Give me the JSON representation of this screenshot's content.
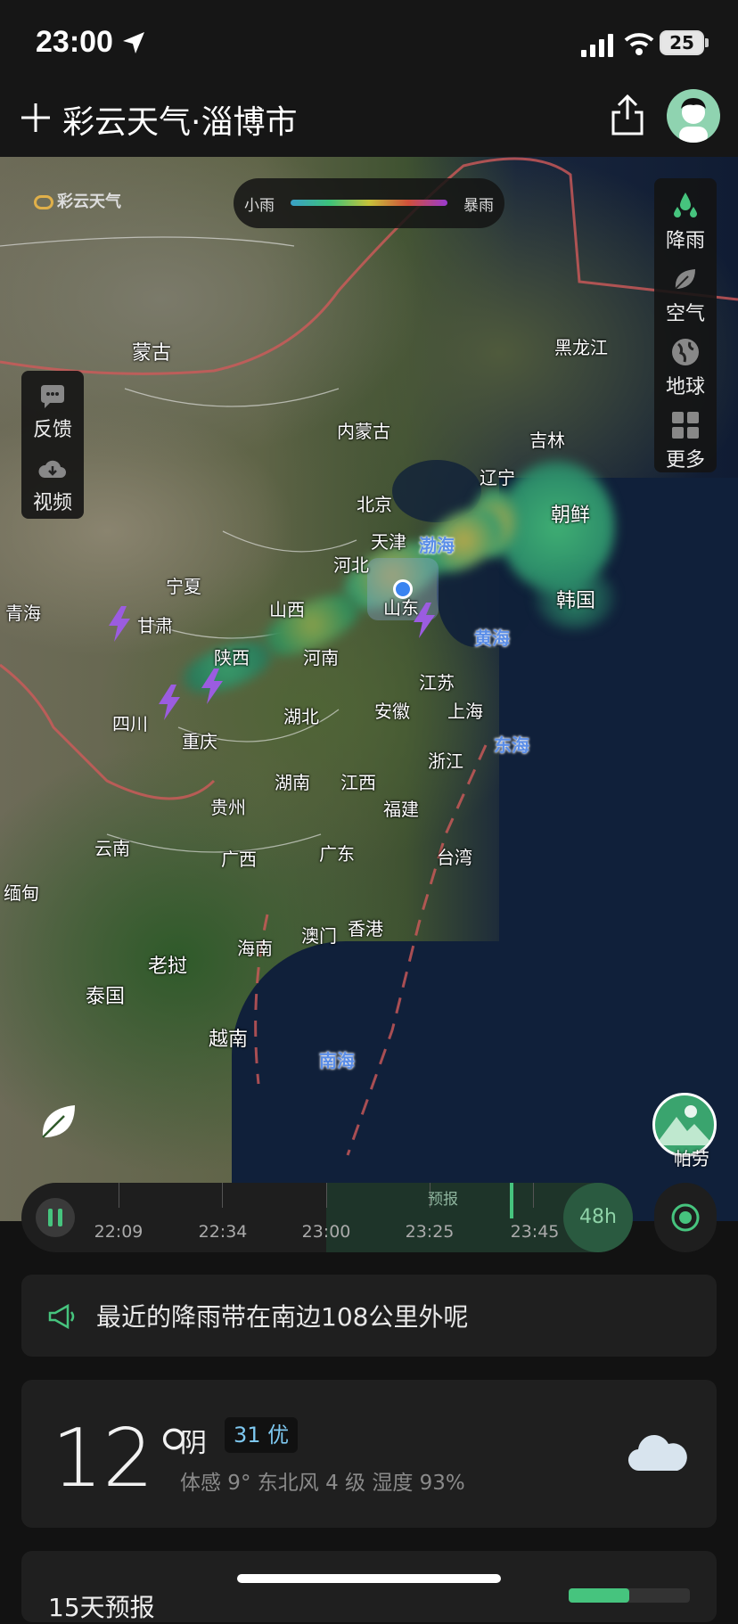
{
  "status": {
    "time": "23:00",
    "battery": "25"
  },
  "header": {
    "title": "彩云天气·淄博市"
  },
  "map": {
    "logo": "彩云天气",
    "legend": {
      "light": "小雨",
      "heavy": "暴雨"
    },
    "right_panel": [
      "降雨",
      "空气",
      "地球",
      "更多"
    ],
    "left_panel": [
      "反馈",
      "视频"
    ],
    "labels": [
      {
        "id": "mongolia",
        "text": "蒙古"
      },
      {
        "id": "heilongjiang",
        "text": "黑龙江"
      },
      {
        "id": "neimenggu",
        "text": "内蒙古"
      },
      {
        "id": "jilin",
        "text": "吉林"
      },
      {
        "id": "liaoning",
        "text": "辽宁"
      },
      {
        "id": "beijing",
        "text": "北京"
      },
      {
        "id": "tianjin",
        "text": "天津"
      },
      {
        "id": "northkorea",
        "text": "朝鲜"
      },
      {
        "id": "hebei",
        "text": "河北"
      },
      {
        "id": "ningxia",
        "text": "宁夏"
      },
      {
        "id": "qinghai",
        "text": "青海"
      },
      {
        "id": "gansu",
        "text": "甘肃"
      },
      {
        "id": "shanxi",
        "text": "山西"
      },
      {
        "id": "shandong",
        "text": "山东"
      },
      {
        "id": "southkorea",
        "text": "韩国"
      },
      {
        "id": "shaanxi",
        "text": "陕西"
      },
      {
        "id": "henan",
        "text": "河南"
      },
      {
        "id": "jiangsu",
        "text": "江苏"
      },
      {
        "id": "sichuan",
        "text": "四川"
      },
      {
        "id": "hubei",
        "text": "湖北"
      },
      {
        "id": "anhui",
        "text": "安徽"
      },
      {
        "id": "shanghai",
        "text": "上海"
      },
      {
        "id": "chongqing",
        "text": "重庆"
      },
      {
        "id": "zhejiang",
        "text": "浙江"
      },
      {
        "id": "hunan",
        "text": "湖南"
      },
      {
        "id": "jiangxi",
        "text": "江西"
      },
      {
        "id": "guizhou",
        "text": "贵州"
      },
      {
        "id": "fujian",
        "text": "福建"
      },
      {
        "id": "yunnan",
        "text": "云南"
      },
      {
        "id": "guangxi",
        "text": "广西"
      },
      {
        "id": "guangdong",
        "text": "广东"
      },
      {
        "id": "taiwan",
        "text": "台湾"
      },
      {
        "id": "myanmar",
        "text": "缅甸"
      },
      {
        "id": "hainan",
        "text": "海南"
      },
      {
        "id": "macau",
        "text": "澳门"
      },
      {
        "id": "hongkong",
        "text": "香港"
      },
      {
        "id": "laos",
        "text": "老挝"
      },
      {
        "id": "thailand",
        "text": "泰国"
      },
      {
        "id": "vietnam",
        "text": "越南"
      },
      {
        "id": "philippines",
        "text": "帕劳"
      }
    ],
    "seas": [
      {
        "id": "bohai",
        "text": "渤海"
      },
      {
        "id": "huanghai",
        "text": "黄海"
      },
      {
        "id": "donghai",
        "text": "东海"
      },
      {
        "id": "nanhai",
        "text": "南海"
      }
    ]
  },
  "timeline": {
    "forecast_label": "预报",
    "times": [
      "22:09",
      "22:34",
      "23:00",
      "23:25",
      "23:45"
    ],
    "range": "48h"
  },
  "notice": {
    "text": "最近的降雨带在南边108公里外呢"
  },
  "weather": {
    "temp": "12°",
    "condition": "阴",
    "aqi": "31 优",
    "details": "体感 9° 东北风 4 级 湿度 93%"
  },
  "forecast_card": {
    "title": "15天预报"
  },
  "colors": {
    "accent": "#46c47e",
    "background": "#121212",
    "card": "#1f1f1f"
  }
}
